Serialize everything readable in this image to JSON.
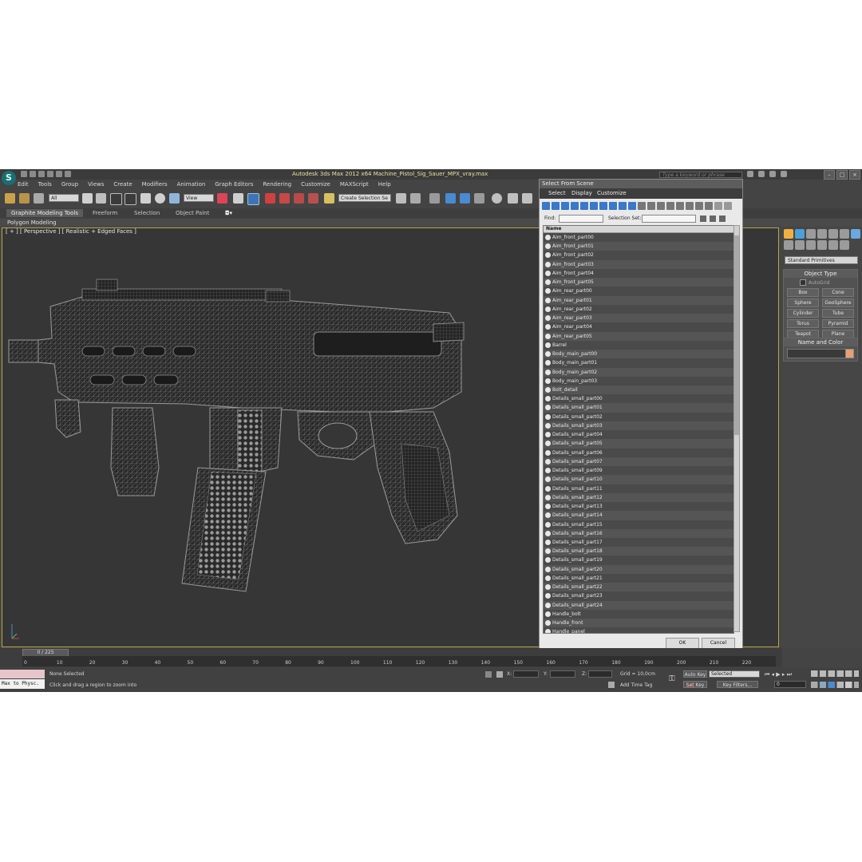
{
  "app": {
    "title": "Autodesk 3ds Max  2012 x64     Machine_Pistol_Sig_Sauer_MPX_vray.max",
    "search_placeholder": "Type a keyword or phrase"
  },
  "menu": [
    "Edit",
    "Tools",
    "Group",
    "Views",
    "Create",
    "Modifiers",
    "Animation",
    "Graph Editors",
    "Rendering",
    "Customize",
    "MAXScript",
    "Help"
  ],
  "toolbar": {
    "filter_value": "All",
    "ref_coord_value": "View",
    "selection_set_value": "Create Selection Se"
  },
  "ribbon": {
    "tabs": [
      "Graphite Modeling Tools",
      "Freeform",
      "Selection",
      "Object Paint"
    ],
    "active_tab": "Graphite Modeling Tools",
    "sub_label": "Polygon Modeling"
  },
  "viewport": {
    "label": "[ + ] [ Perspective ] [ Realistic + Edged Faces ]"
  },
  "command_panel": {
    "category": "Standard Primitives",
    "object_type_title": "Object Type",
    "autogrid_label": "AutoGrid",
    "primitives": [
      "Box",
      "Cone",
      "Sphere",
      "GeoSphere",
      "Cylinder",
      "Tube",
      "Torus",
      "Pyramid",
      "Teapot",
      "Plane"
    ],
    "name_color_title": "Name and Color",
    "object_color": "#e8a070"
  },
  "dialog": {
    "title": "Select From Scene",
    "menu": [
      "Select",
      "Display",
      "Customize"
    ],
    "find_label": "Find:",
    "selection_set_label": "Selection Set:",
    "column_header": "Name",
    "items": [
      "Aim_front_part00",
      "Aim_front_part01",
      "Aim_front_part02",
      "Aim_front_part03",
      "Aim_front_part04",
      "Aim_front_part05",
      "Aim_rear_part00",
      "Aim_rear_part01",
      "Aim_rear_part02",
      "Aim_rear_part03",
      "Aim_rear_part04",
      "Aim_rear_part05",
      "Barrel",
      "Body_main_part00",
      "Body_main_part01",
      "Body_main_part02",
      "Body_main_part03",
      "Bolt_detail",
      "Details_small_part00",
      "Details_small_part01",
      "Details_small_part02",
      "Details_small_part03",
      "Details_small_part04",
      "Details_small_part05",
      "Details_small_part06",
      "Details_small_part07",
      "Details_small_part09",
      "Details_small_part10",
      "Details_small_part11",
      "Details_small_part12",
      "Details_small_part13",
      "Details_small_part14",
      "Details_small_part15",
      "Details_small_part16",
      "Details_small_part17",
      "Details_small_part18",
      "Details_small_part19",
      "Details_small_part20",
      "Details_small_part21",
      "Details_small_part22",
      "Details_small_part23",
      "Details_small_part24",
      "Handle_bolt",
      "Handle_front",
      "Handle_panel"
    ],
    "ok_label": "OK",
    "cancel_label": "Cancel"
  },
  "timeline": {
    "frame_display": "0 / 225",
    "ticks": [
      "0",
      "10",
      "20",
      "30",
      "40",
      "50",
      "60",
      "70",
      "80",
      "90",
      "100",
      "110",
      "120",
      "130",
      "140",
      "150",
      "160",
      "170",
      "180",
      "190",
      "200",
      "210",
      "220"
    ]
  },
  "status": {
    "listener_text": "Max to Physc.",
    "selection_status": "None Selected",
    "prompt": "Click and drag a region to zoom into",
    "x_label": "X:",
    "y_label": "Y:",
    "z_label": "Z:",
    "grid": "Grid = 10,0cm",
    "add_time_tag": "Add Time Tag",
    "auto_key": "Auto Key",
    "set_key": "Set Key",
    "key_mode_value": "Selected",
    "key_filters": "Key Filters...",
    "frame_value": "0"
  }
}
